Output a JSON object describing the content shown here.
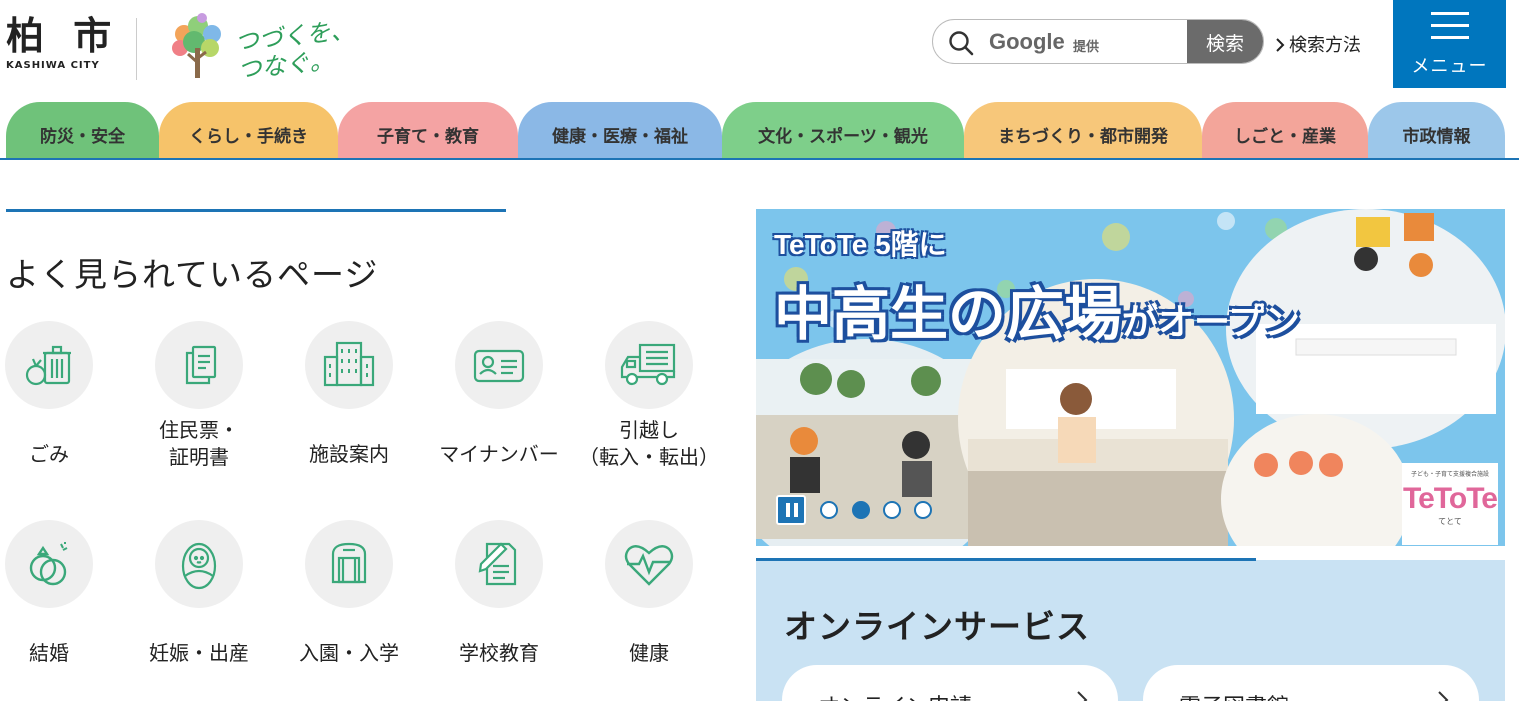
{
  "header": {
    "city_kanji": "柏 市",
    "city_roman": "KASHIWA CITY",
    "slogan_line1": "つづくを、",
    "slogan_line2": "つなぐ。",
    "search": {
      "brand": "Google",
      "brand_sub": "提供",
      "button_label": "検索",
      "help_label": "検索方法"
    },
    "menu_label": "メニュー"
  },
  "nav": {
    "tabs": [
      {
        "label": "防災・安全",
        "color": "#6fc27a"
      },
      {
        "label": "くらし・手続き",
        "color": "#f6c36a"
      },
      {
        "label": "子育て・教育",
        "color": "#f4a3a3"
      },
      {
        "label": "健康・医療・福祉",
        "color": "#8bb8e6"
      },
      {
        "label": "文化・スポーツ・観光",
        "color": "#7ecf8a"
      },
      {
        "label": "まちづくり・都市開発",
        "color": "#f7c77a"
      },
      {
        "label": "しごと・産業",
        "color": "#f3a59a"
      },
      {
        "label": "市政情報",
        "color": "#9cc7ea"
      }
    ]
  },
  "popular": {
    "title": "よく見られているページ",
    "items": [
      {
        "label": "ごみ",
        "icon": "garbage-icon"
      },
      {
        "label": "住民票・\n証明書",
        "icon": "document-icon"
      },
      {
        "label": "施設案内",
        "icon": "building-icon"
      },
      {
        "label": "マイナンバー",
        "icon": "id-card-icon"
      },
      {
        "label": "引越し\n（転入・転出）",
        "icon": "truck-icon"
      },
      {
        "label": "結婚",
        "icon": "rings-icon"
      },
      {
        "label": "妊娠・出産",
        "icon": "baby-icon"
      },
      {
        "label": "入園・入学",
        "icon": "school-bag-icon"
      },
      {
        "label": "学校教育",
        "icon": "pen-paper-icon"
      },
      {
        "label": "健康",
        "icon": "heart-pulse-icon"
      }
    ]
  },
  "banner": {
    "line1": "TeToTe 5階に",
    "line2_main": "中高生の広場",
    "line2_tail": "がオープン",
    "logo_sub": "子ども・子育て支援複合施設",
    "logo": "TeToTe",
    "logo_kana": "てとて",
    "slide_count": 4,
    "active_slide": 2
  },
  "online": {
    "title": "オンラインサービス",
    "cards": [
      {
        "label": "オンライン申請"
      },
      {
        "label": "電子図書館"
      }
    ]
  },
  "colors": {
    "accent": "#1d74b5",
    "menu": "#0076be",
    "icon_green": "#3aa87a"
  }
}
